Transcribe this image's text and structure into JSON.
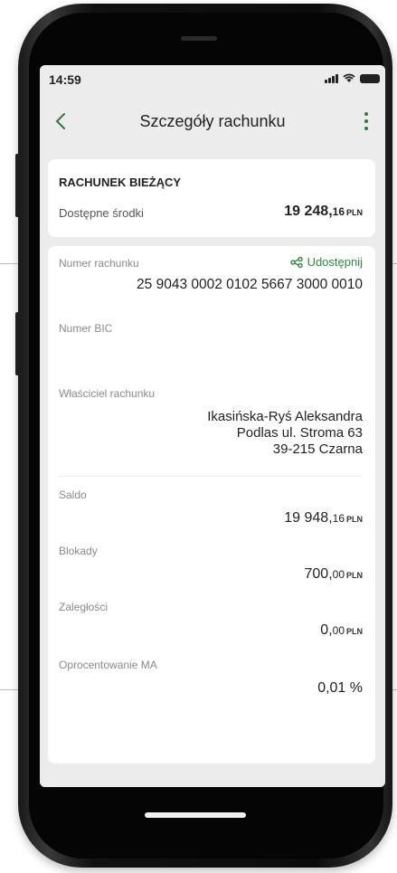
{
  "status_bar": {
    "time": "14:59"
  },
  "app_bar": {
    "back_icon": "chevron-left-icon",
    "title": "Szczegóły rachunku",
    "menu_icon": "more-vertical-icon"
  },
  "summary": {
    "account_type": "RACHUNEK BIEŻĄCY",
    "available_label": "Dostępne środki",
    "available_int": "19 248,",
    "available_dec": "16",
    "available_currency": "PLN"
  },
  "details": {
    "account_number_label": "Numer rachunku",
    "share_label": "Udostępnij",
    "account_number": "25 9043 0002 0102 5667 3000 0010",
    "bic_label": "Numer BIC",
    "owner_label": "Właściciel rachunku",
    "owner_name": "Ikasińska-Ryś Aleksandra",
    "owner_street": "Podlas ul. Stroma 63",
    "owner_city": "39-215 Czarna",
    "saldo_label": "Saldo",
    "saldo_int": "19 948,",
    "saldo_dec": "16",
    "saldo_currency": "PLN",
    "blokady_label": "Blokady",
    "blokady_int": "700,",
    "blokady_dec": "00",
    "blokady_currency": "PLN",
    "zaleglosci_label": "Zaległości",
    "zaleglosci_int": "0,",
    "zaleglosci_dec": "00",
    "zaleglosci_currency": "PLN",
    "interest_label": "Oprocentowanie MA",
    "interest_value": "0,01 %"
  },
  "colors": {
    "accent_green": "#2b8a3e",
    "screen_bg": "#ececec",
    "card_bg": "#ffffff"
  }
}
